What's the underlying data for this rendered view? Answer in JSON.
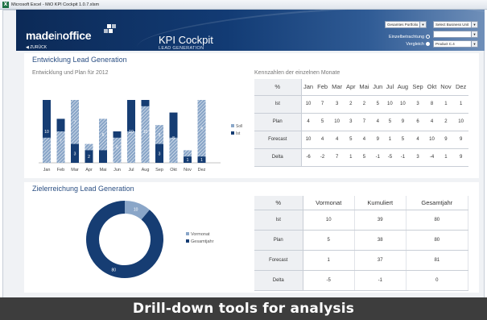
{
  "window": {
    "title": "Microsoft Excel - MiO KPI Cockpit 1.0.7.xlsm"
  },
  "header": {
    "logo_a": "made",
    "logo_b": "in",
    "logo_c": "office",
    "back": "◀ ZURÜCK",
    "app_title": "KPI Cockpit",
    "app_subtitle": "LEAD GENERATION",
    "portfolio_select": "Gesamtes Portfolio",
    "business_select": "Select Business Unit",
    "blank_select": "",
    "product_select": "Product C.4",
    "einzel_label": "Einzelbetrachtung",
    "vergleich_label": "Vergleich"
  },
  "section1": {
    "title": "Entwicklung Lead Generation",
    "subtitle": "Entwicklung und Plan für 2012",
    "table_title": "Kennzahlen der einzelnen Monate",
    "legend": [
      "Soll",
      "Ist"
    ],
    "colors": {
      "ist": "#163d73",
      "soll": "#8aa6c8"
    }
  },
  "chart_data": [
    {
      "type": "bar",
      "categories": [
        "Jan",
        "Feb",
        "Mar",
        "Apr",
        "Mai",
        "Jun",
        "Jul",
        "Aug",
        "Sep",
        "Okt",
        "Nov",
        "Dez"
      ],
      "series": [
        {
          "name": "Soll",
          "values": [
            4,
            5,
            10,
            3,
            7,
            4,
            5,
            9,
            6,
            4,
            2,
            10
          ]
        },
        {
          "name": "Ist",
          "values": [
            10,
            7,
            3,
            2,
            2,
            5,
            10,
            10,
            3,
            8,
            1,
            1
          ]
        }
      ],
      "data_labels": {
        "Ist": [
          "10",
          "7",
          "3",
          "2",
          "",
          "5",
          "10",
          "10",
          "3",
          "8",
          "1",
          "1"
        ],
        "Soll": [
          "",
          "",
          "7",
          "",
          "5",
          "",
          "",
          "",
          "3",
          "",
          "",
          "4"
        ]
      },
      "ylim": [
        0,
        10
      ]
    },
    {
      "type": "pie",
      "labels": [
        "Vormonat",
        "Gesamtjahr"
      ],
      "values": [
        10,
        80
      ]
    }
  ],
  "monthly_table": {
    "columns": [
      "%",
      "Jan",
      "Feb",
      "Mar",
      "Apr",
      "Mai",
      "Jun",
      "Jul",
      "Aug",
      "Sep",
      "Okt",
      "Nov",
      "Dez"
    ],
    "rows": [
      {
        "label": "Ist",
        "values": [
          "10",
          "7",
          "3",
          "2",
          "2",
          "5",
          "10",
          "10",
          "3",
          "8",
          "1",
          "1"
        ]
      },
      {
        "label": "Plan",
        "values": [
          "4",
          "5",
          "10",
          "3",
          "7",
          "4",
          "5",
          "9",
          "6",
          "4",
          "2",
          "10"
        ]
      },
      {
        "label": "Forecast",
        "values": [
          "10",
          "4",
          "4",
          "5",
          "4",
          "9",
          "1",
          "5",
          "4",
          "10",
          "9",
          "9"
        ]
      },
      {
        "label": "Delta",
        "values": [
          "-6",
          "-2",
          "7",
          "1",
          "5",
          "-1",
          "-5",
          "-1",
          "3",
          "-4",
          "1",
          "9"
        ]
      }
    ]
  },
  "section2": {
    "title": "Zielerreichung Lead Generation",
    "legend": [
      "Vormonat",
      "Gesamtjahr"
    ],
    "colors": {
      "vormonat": "#8aa6c8",
      "gesamtjahr": "#163d73"
    },
    "slice_labels": [
      "10",
      "80"
    ]
  },
  "goal_table": {
    "columns": [
      "%",
      "Vormonat",
      "Kumuliert",
      "Gesamtjahr"
    ],
    "rows": [
      {
        "label": "Ist",
        "values": [
          "10",
          "39",
          "80"
        ]
      },
      {
        "label": "Plan",
        "values": [
          "5",
          "38",
          "80"
        ]
      },
      {
        "label": "Forecast",
        "values": [
          "1",
          "37",
          "81"
        ]
      },
      {
        "label": "Delta",
        "values": [
          "-5",
          "-1",
          "0"
        ]
      }
    ]
  },
  "caption": "Drill-down tools for analysis"
}
